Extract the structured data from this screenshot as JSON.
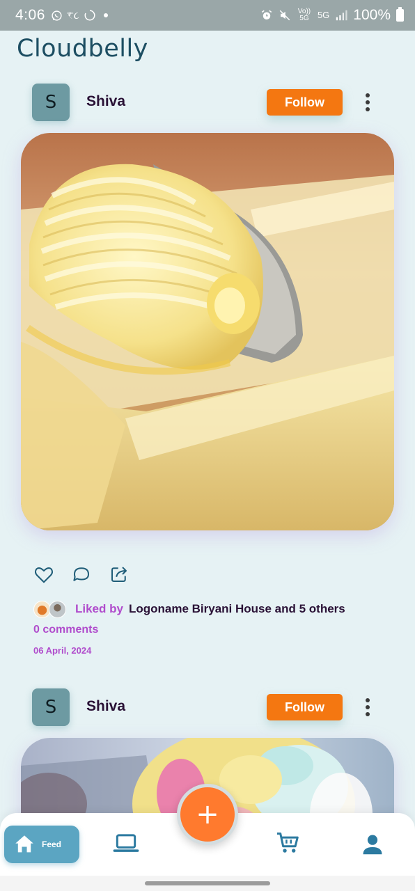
{
  "status_bar": {
    "time": "4:06",
    "left_icons": [
      "whatsapp-icon",
      "rupee-glyph",
      "loading-icon",
      "dot"
    ],
    "rupee_text": "₹૮",
    "right_icons": [
      "alarm-icon",
      "mute-icon",
      "volte-icon",
      "5g-icon",
      "signal-icon"
    ],
    "volte_text": "Vo)) 5G",
    "net_text": "5G",
    "battery": "100%"
  },
  "app": {
    "title": "Cloudbelly"
  },
  "posts": [
    {
      "author_initial": "S",
      "author_name": "Shiva",
      "follow_label": "Follow",
      "image": "butter-curl",
      "liked_by_label": "Liked by",
      "liked_by_names": "Logoname Biryani House and 5 others",
      "comments": "0 comments",
      "date": "06 April, 2024"
    },
    {
      "author_initial": "S",
      "author_name": "Shiva",
      "follow_label": "Follow",
      "image": "ice-cream-scoop"
    }
  ],
  "bottom_nav": {
    "feed_label": "Feed",
    "items": [
      "home-icon",
      "laptop-icon",
      "add-icon",
      "cart-icon",
      "profile-icon"
    ]
  },
  "colors": {
    "accent_orange": "#f47711",
    "brand_teal": "#5ba5c2",
    "title": "#1d4e62",
    "link_purple": "#b04ccc",
    "background": "#e6f2f4"
  }
}
